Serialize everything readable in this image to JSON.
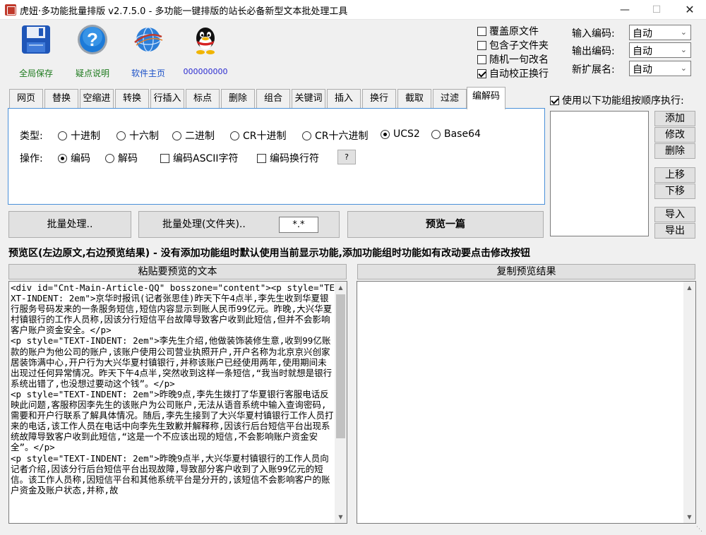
{
  "window": {
    "title": "虎妞·多功能批量排版 v2.7.5.0 - 多功能一键排版的站长必备新型文本批处理工具"
  },
  "toolbar": {
    "save_label": "全局保存",
    "help_label": "疑点说明",
    "home_label": "软件主页",
    "qq_label": "000000000"
  },
  "options": {
    "overwrite": "覆盖原文件",
    "subdir": "包含子文件夹",
    "rename": "随机一句改名",
    "autofix": "自动校正换行"
  },
  "encoding": {
    "input_label": "输入编码:",
    "input_value": "自动",
    "output_label": "输出编码:",
    "output_value": "自动",
    "ext_label": "新扩展名:",
    "ext_value": "自动"
  },
  "tabs": [
    {
      "label": "网页"
    },
    {
      "label": "替换"
    },
    {
      "label": "空缩进"
    },
    {
      "label": "转换"
    },
    {
      "label": "行插入"
    },
    {
      "label": "标点"
    },
    {
      "label": "删除"
    },
    {
      "label": "组合"
    },
    {
      "label": "关键词"
    },
    {
      "label": "插入"
    },
    {
      "label": "换行"
    },
    {
      "label": "截取"
    },
    {
      "label": "过滤"
    },
    {
      "label": "编解码"
    }
  ],
  "codec_panel": {
    "type_label": "类型:",
    "types": [
      "十进制",
      "十六制",
      "二进制",
      "CR十进制",
      "CR十六进制",
      "UCS2",
      "Base64"
    ],
    "selected_type": "UCS2",
    "op_label": "操作:",
    "ops": [
      "编码",
      "解码"
    ],
    "selected_op": "编码",
    "encode_ascii": "编码ASCII字符",
    "encode_newline": "编码换行符",
    "help_btn": "?"
  },
  "function_group": {
    "sequence_label": "使用以下功能组按顺序执行:",
    "add": "添加",
    "modify": "修改",
    "delete": "删除",
    "up": "上移",
    "down": "下移",
    "import": "导入",
    "export": "导出"
  },
  "actions": {
    "batch": "批量处理..",
    "batch_folder": "批量处理(文件夹)..",
    "pattern": "*.*",
    "preview_one": "预览一篇"
  },
  "preview": {
    "title": "预览区(左边原文,右边预览结果) - 没有添加功能组时默认使用当前显示功能,添加功能组时功能如有改动要点击修改按钮",
    "left_header": "粘贴要预览的文本",
    "right_header": "复制预览结果",
    "source_text": "<div id=\"Cnt-Main-Article-QQ\" bosszone=\"content\"><p style=\"TEXT-INDENT: 2em\">京华时报讯(记者张思佳)昨天下午4点半,李先生收到华夏银行服务号码发来的一条服务短信,短信内容显示到账人民币99亿元。昨晚,大兴华夏村镇银行的工作人员称,因该分行短信平台故障导致客户收到此短信,但并不会影响客户账户资金安全。</p>\n<p style=\"TEXT-INDENT: 2em\">李先生介绍,他做装饰装修生意,收到99亿账款的账户为他公司的账户,该账户使用公司营业执照开户,开户名称为北京京兴创家居装饰满中心,开户行为大兴华夏村镇银行,并称该账户已经使用两年,使用期间未出现过任何异常情况。昨天下午4点半,突然收到这样一条短信,“我当时就想是银行系统出错了,也没想过要动这个钱”。</p>\n<p style=\"TEXT-INDENT: 2em\">昨晚9点,李先生拨打了华夏银行客服电话反映此问题,客服称因李先生的该账户为公司账户,无法从语音系统中输入查询密码,需要和开户行联系了解具体情况。随后,李先生接到了大兴华夏村镇银行工作人员打来的电话,该工作人员在电话中向李先生致歉并解释称,因该行后台短信平台出现系统故障导致客户收到此短信,“这是一个不应该出现的短信,不会影响账户资金安全”。</p>\n<p style=\"TEXT-INDENT: 2em\">昨晚9点半,大兴华夏村镇银行的工作人员向记者介绍,因该分行后台短信平台出现故障,导致部分客户收到了入账99亿元的短信。该工作人员称,因短信平台和其他系统平台是分开的,该短信不会影响客户的账户资金及账户状态,并称,故"
  }
}
